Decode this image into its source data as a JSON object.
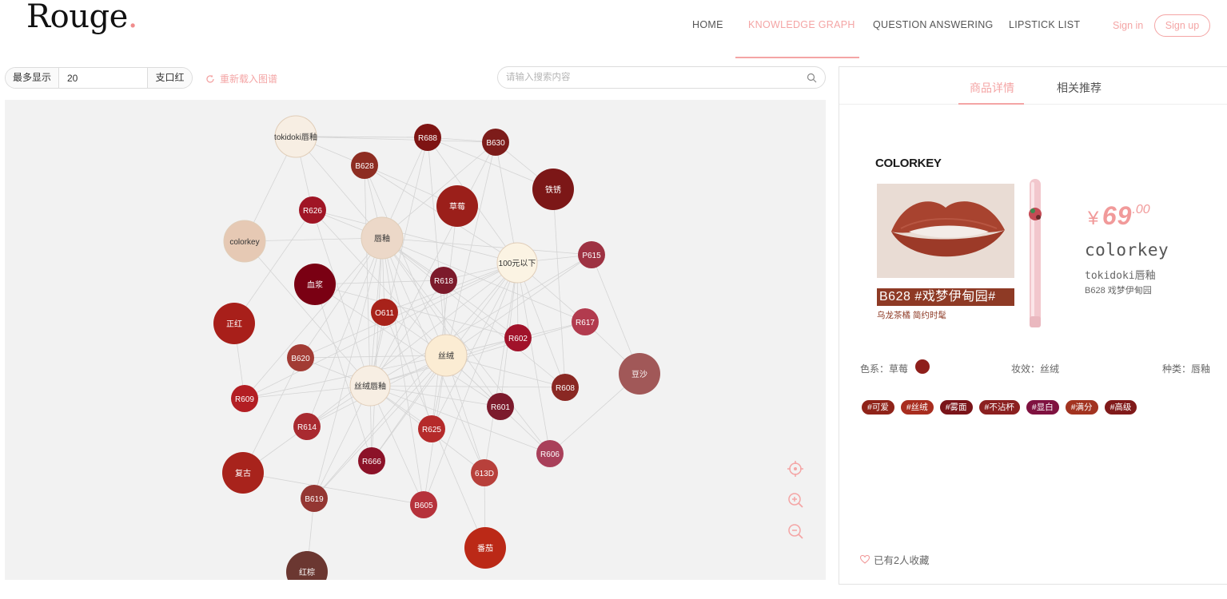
{
  "header": {
    "logo": "Rouge",
    "logo_dot": ".",
    "nav": [
      {
        "label": "HOME",
        "active": false
      },
      {
        "label": "KNOWLEDGE GRAPH",
        "active": true
      },
      {
        "label": "QUESTION ANSWERING",
        "active": false
      },
      {
        "label": "LIPSTICK LIST",
        "active": false
      }
    ],
    "sign_in": "Sign in",
    "sign_up": "Sign up"
  },
  "toolbar": {
    "max_show_label": "最多显示",
    "max_show_value": "20",
    "unit_label": "支口红",
    "reload_label": "重新载入图谱",
    "search_placeholder": "请输入搜索内容"
  },
  "graph": {
    "nodes": [
      {
        "id": "tokidoki唇釉",
        "kind": "series",
        "color": "#f7eee3",
        "text": "#333"
      },
      {
        "id": "R688",
        "kind": "shade",
        "color": "#7e1413",
        "text": "#fff"
      },
      {
        "id": "B630",
        "kind": "shade",
        "color": "#7d1c1a",
        "text": "#fff"
      },
      {
        "id": "B628",
        "kind": "shade",
        "color": "#8e2d22",
        "text": "#fff"
      },
      {
        "id": "铁锈",
        "kind": "color",
        "color": "#7c1717",
        "text": "#fff"
      },
      {
        "id": "草莓",
        "kind": "color",
        "color": "#9b1f1a",
        "text": "#fff"
      },
      {
        "id": "R626",
        "kind": "shade",
        "color": "#a01525",
        "text": "#fff"
      },
      {
        "id": "colorkey",
        "kind": "brand",
        "color": "#e6c9b4",
        "text": "#333"
      },
      {
        "id": "唇釉",
        "kind": "type",
        "color": "#ecd8c8",
        "text": "#333"
      },
      {
        "id": "100元以下",
        "kind": "price",
        "color": "#fbf3e3",
        "text": "#333"
      },
      {
        "id": "P615",
        "kind": "shade",
        "color": "#9e3242",
        "text": "#fff"
      },
      {
        "id": "血浆",
        "kind": "color",
        "color": "#7a0013",
        "text": "#fff"
      },
      {
        "id": "R618",
        "kind": "shade",
        "color": "#7c1a2b",
        "text": "#fff"
      },
      {
        "id": "正红",
        "kind": "color",
        "color": "#a81f1a",
        "text": "#fff"
      },
      {
        "id": "O611",
        "kind": "shade",
        "color": "#a8221a",
        "text": "#fff"
      },
      {
        "id": "R617",
        "kind": "shade",
        "color": "#b23b4e",
        "text": "#fff"
      },
      {
        "id": "R602",
        "kind": "shade",
        "color": "#a1122a",
        "text": "#fff"
      },
      {
        "id": "丝绒",
        "kind": "texture",
        "color": "#fbecd3",
        "text": "#333"
      },
      {
        "id": "B620",
        "kind": "shade",
        "color": "#a23b34",
        "text": "#fff"
      },
      {
        "id": "豆沙",
        "kind": "color",
        "color": "#a15858",
        "text": "#fff"
      },
      {
        "id": "丝绒唇釉",
        "kind": "series",
        "color": "#f7eee3",
        "text": "#333"
      },
      {
        "id": "R608",
        "kind": "shade",
        "color": "#8a2823",
        "text": "#fff"
      },
      {
        "id": "R609",
        "kind": "shade",
        "color": "#b31e23",
        "text": "#fff"
      },
      {
        "id": "R601",
        "kind": "shade",
        "color": "#7c1a2c",
        "text": "#fff"
      },
      {
        "id": "R614",
        "kind": "shade",
        "color": "#a92a30",
        "text": "#fff"
      },
      {
        "id": "R625",
        "kind": "shade",
        "color": "#b52a2a",
        "text": "#fff"
      },
      {
        "id": "R606",
        "kind": "shade",
        "color": "#a9405a",
        "text": "#fff"
      },
      {
        "id": "R666",
        "kind": "shade",
        "color": "#8c1228",
        "text": "#fff"
      },
      {
        "id": "复古",
        "kind": "color",
        "color": "#a8231c",
        "text": "#fff"
      },
      {
        "id": "613D",
        "kind": "shade",
        "color": "#b8403b",
        "text": "#fff"
      },
      {
        "id": "B619",
        "kind": "shade",
        "color": "#943632",
        "text": "#fff"
      },
      {
        "id": "B605",
        "kind": "shade",
        "color": "#b6323b",
        "text": "#fff"
      },
      {
        "id": "番茄",
        "kind": "color",
        "color": "#bb2917",
        "text": "#fff"
      },
      {
        "id": "红棕",
        "kind": "color",
        "color": "#6b3731",
        "text": "#fff"
      }
    ],
    "tools": [
      {
        "name": "locate-icon"
      },
      {
        "name": "zoom-in-icon"
      },
      {
        "name": "zoom-out-icon"
      }
    ]
  },
  "panel": {
    "tabs": [
      {
        "label": "商品详情",
        "active": true
      },
      {
        "label": "相关推荐",
        "active": false
      }
    ],
    "product": {
      "logo_text": "COLORKEY",
      "banner": "B628 #戏梦伊甸园#",
      "banner_sub": "乌龙茶橘  简约时髦",
      "price_symbol": "¥",
      "price_int": "69",
      "price_dec": ".00",
      "brand": "colorkey",
      "series": "tokidoki唇釉",
      "shade": "B628 戏梦伊甸园"
    },
    "attributes": {
      "color_family": "色系：草莓",
      "color_swatch": "#8e1f1b",
      "effect": "妆效：丝绒",
      "type": "种类：唇釉"
    },
    "tags": [
      {
        "label": "#可爱",
        "color": "#8f2319"
      },
      {
        "label": "#丝绒",
        "color": "#a82d1f"
      },
      {
        "label": "#雾面",
        "color": "#7a1419"
      },
      {
        "label": "#不沾杯",
        "color": "#8b2020"
      },
      {
        "label": "#显白",
        "color": "#7f1240"
      },
      {
        "label": "#满分",
        "color": "#a23320"
      },
      {
        "label": "#高级",
        "color": "#801a1a"
      }
    ],
    "favorites": "已有2人收藏"
  },
  "colors": {
    "accent": "#f4a5a5",
    "graph_bg": "#f2f2f2"
  }
}
